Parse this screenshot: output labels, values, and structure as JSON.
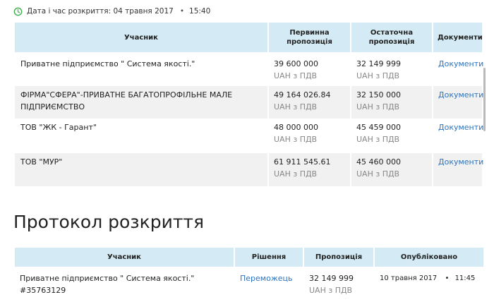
{
  "opening": {
    "label": "Дата і час розкриття:",
    "date": "04 травня 2017",
    "separator": "•",
    "time": "15:40"
  },
  "bids_table": {
    "headers": {
      "participant": "Учасник",
      "initial_offer": "Первинна пропозиція",
      "final_offer": "Остаточна пропозиція",
      "documents": "Документи"
    },
    "rows": [
      {
        "participant": "Приватне підприємство \" Система якості.\"",
        "initial": "39 600 000",
        "initial_sub": "UAH з ПДВ",
        "final": "32 149 999",
        "final_sub": "UAH з ПДВ",
        "documents": "Документи"
      },
      {
        "participant": "ФІРМА\"СФЕРА\"-ПРИВАТНЕ БАГАТОПРОФІЛЬНЕ МАЛЕ ПІДПРИЄМСТВО",
        "initial": "49 164 026.84",
        "initial_sub": "UAH з ПДВ",
        "final": "32 150 000",
        "final_sub": "UAH з ПДВ",
        "documents": "Документи"
      },
      {
        "participant": "ТОВ \"ЖК - Гарант\"",
        "initial": "48 000 000",
        "initial_sub": "UAH з ПДВ",
        "final": "45 459 000",
        "final_sub": "UAH з ПДВ",
        "documents": "Документи"
      },
      {
        "participant": "ТОВ \"МУР\"",
        "initial": "61 911 545.61",
        "initial_sub": "UAH з ПДВ",
        "final": "45 460 000",
        "final_sub": "UAH з ПДВ",
        "documents": "Документи"
      }
    ]
  },
  "protocol": {
    "title": "Протокол розкриття",
    "headers": {
      "participant": "Учасник",
      "decision": "Рішення",
      "offer": "Пропозиція",
      "published": "Опубліковано"
    },
    "rows": [
      {
        "participant": "Приватне підприємство \" Система якості.\"",
        "participant_id": "#35763129",
        "decision": "Переможець",
        "offer": "32 149 999",
        "offer_sub": "UAH з ПДВ",
        "published_date": "10 травня 2017",
        "published_sep": "•",
        "published_time": "11:45"
      }
    ]
  },
  "colors": {
    "header_bg": "#d4ebf5",
    "row_alt_bg": "#f1f1f1",
    "link": "#2a73c0",
    "clock_icon": "#3fb24f"
  },
  "icons": {
    "opening_time": "clock-icon"
  }
}
